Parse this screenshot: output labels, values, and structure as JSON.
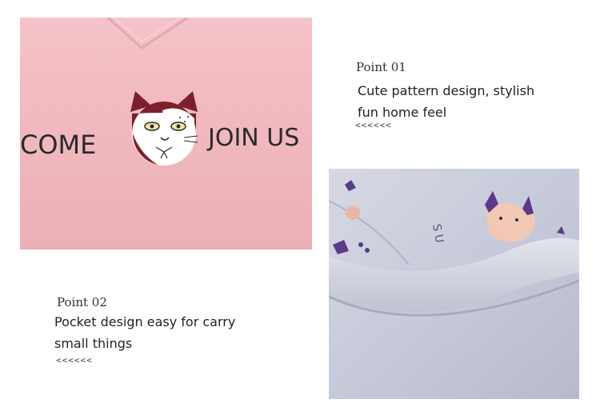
{
  "photos": {
    "shirt_print": {
      "word_left": "COME",
      "word_right": "JOIN US",
      "colors": {
        "fabric": "#f1b9bf",
        "ink": "#2a2a2a",
        "cat_ears": "#7b1f2f"
      }
    },
    "pocket_fabric": {
      "colors": {
        "fabric": "#c9cddd",
        "accent": "#5b3a8a"
      }
    }
  },
  "point1": {
    "title": "Point 01",
    "line1": "Cute pattern design, stylish",
    "line2": "fun home feel",
    "arrows": "<<<<<<"
  },
  "point2": {
    "title": "Point 02",
    "line1": "Pocket design easy for carry",
    "line2": "small things",
    "arrows": "<<<<<<"
  }
}
